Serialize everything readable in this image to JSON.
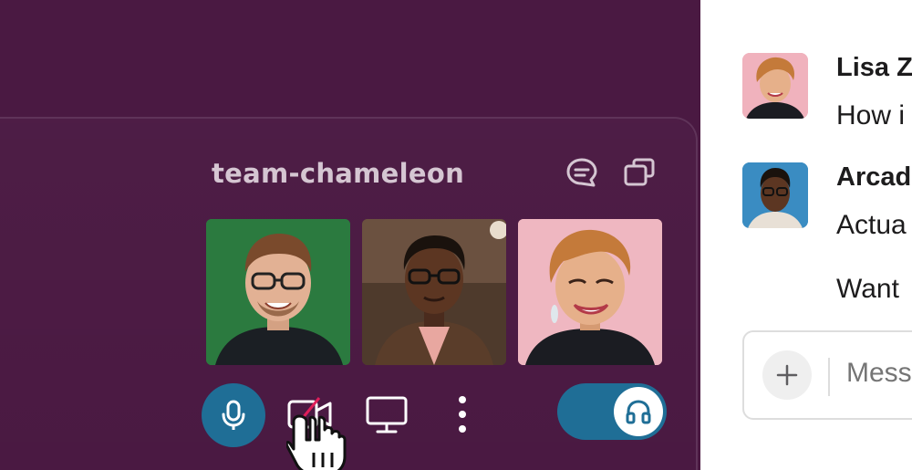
{
  "huddle": {
    "channel_name": "team-chameleon",
    "header_icons": [
      "thread-icon",
      "popout-window-icon"
    ],
    "participants": [
      {
        "tile_bg": "#2b7a3f"
      },
      {
        "tile_bg": "#5a4233"
      },
      {
        "tile_bg": "#e9a6b2"
      }
    ],
    "controls": {
      "mic": {
        "icon": "microphone-icon",
        "active": true
      },
      "camera": {
        "icon": "video-off-icon"
      },
      "screen_share": {
        "icon": "monitor-icon"
      },
      "more": {
        "icon": "more-vertical-icon"
      },
      "headphones": {
        "icon": "headphones-icon",
        "on": true
      }
    }
  },
  "chat": {
    "messages": [
      {
        "sender": "Lisa Z",
        "text": "How i"
      },
      {
        "sender": "Arcad",
        "text": "Actua"
      },
      {
        "sender": "",
        "text": "Want"
      }
    ],
    "composer": {
      "placeholder": "Mess",
      "add_icon": "plus-icon"
    }
  },
  "colors": {
    "aubergine": "#4a1942",
    "accent_blue": "#1f6e96",
    "title_text": "#d5c6d2"
  }
}
